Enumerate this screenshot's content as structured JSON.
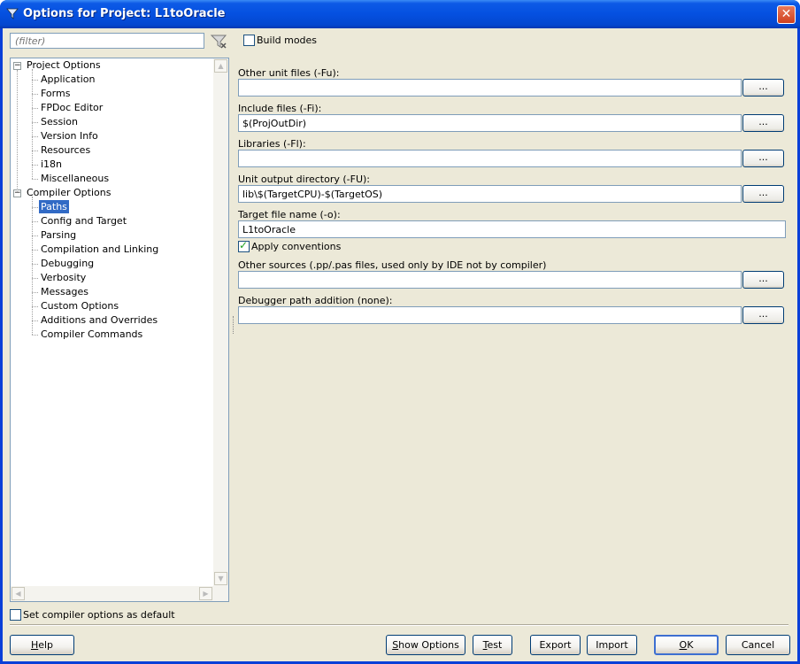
{
  "window": {
    "title": "Options for Project: L1toOracle",
    "close_label": "✕"
  },
  "filter": {
    "placeholder": "(filter)",
    "icon": "filter-clear-icon"
  },
  "tree": {
    "groups": [
      {
        "label": "Project Options",
        "expander": "−",
        "items": [
          "Application",
          "Forms",
          "FPDoc Editor",
          "Session",
          "Version Info",
          "Resources",
          "i18n",
          "Miscellaneous"
        ]
      },
      {
        "label": "Compiler Options",
        "expander": "−",
        "items": [
          "Paths",
          "Config and Target",
          "Parsing",
          "Compilation and Linking",
          "Debugging",
          "Verbosity",
          "Messages",
          "Custom Options",
          "Additions and Overrides",
          "Compiler Commands"
        ]
      }
    ],
    "selected": "Paths"
  },
  "build_modes": {
    "label": "Build modes",
    "checked": false
  },
  "paths": {
    "other_unit_files": {
      "label": "Other unit files (-Fu):",
      "value": "",
      "browse": "..."
    },
    "include_files": {
      "label": "Include files (-Fi):",
      "value": "$(ProjOutDir)",
      "browse": "..."
    },
    "libraries": {
      "label": "Libraries (-Fl):",
      "value": "",
      "browse": "..."
    },
    "unit_output_dir": {
      "label": "Unit output directory (-FU):",
      "value": "lib\\$(TargetCPU)-$(TargetOS)",
      "browse": "..."
    },
    "target_file_name": {
      "label": "Target file name (-o):",
      "value": "L1toOracle"
    },
    "apply_conventions": {
      "label": "Apply conventions",
      "checked": true
    },
    "other_sources": {
      "label": "Other sources (.pp/.pas files, used only by IDE not by compiler)",
      "value": "",
      "browse": "..."
    },
    "debugger_path": {
      "label": "Debugger path addition (none):",
      "value": "",
      "browse": "..."
    }
  },
  "set_default": {
    "label": "Set compiler options as default",
    "checked": false
  },
  "buttons": {
    "help": {
      "prefix": "",
      "mnemonic": "H",
      "rest": "elp"
    },
    "show_options": {
      "prefix": "",
      "mnemonic": "S",
      "rest": "how Options"
    },
    "test": {
      "prefix": "",
      "mnemonic": "T",
      "rest": "est"
    },
    "export": {
      "prefix": "",
      "mnemonic": "",
      "rest": "Export"
    },
    "import": {
      "prefix": "",
      "mnemonic": "",
      "rest": "Import"
    },
    "ok": {
      "prefix": "",
      "mnemonic": "O",
      "rest": "K"
    },
    "cancel": {
      "prefix": "",
      "mnemonic": "",
      "rest": "Cancel"
    }
  },
  "colors": {
    "title_bar": "#0550e0",
    "selection": "#316ac5",
    "dialog_bg": "#ece9d8"
  }
}
